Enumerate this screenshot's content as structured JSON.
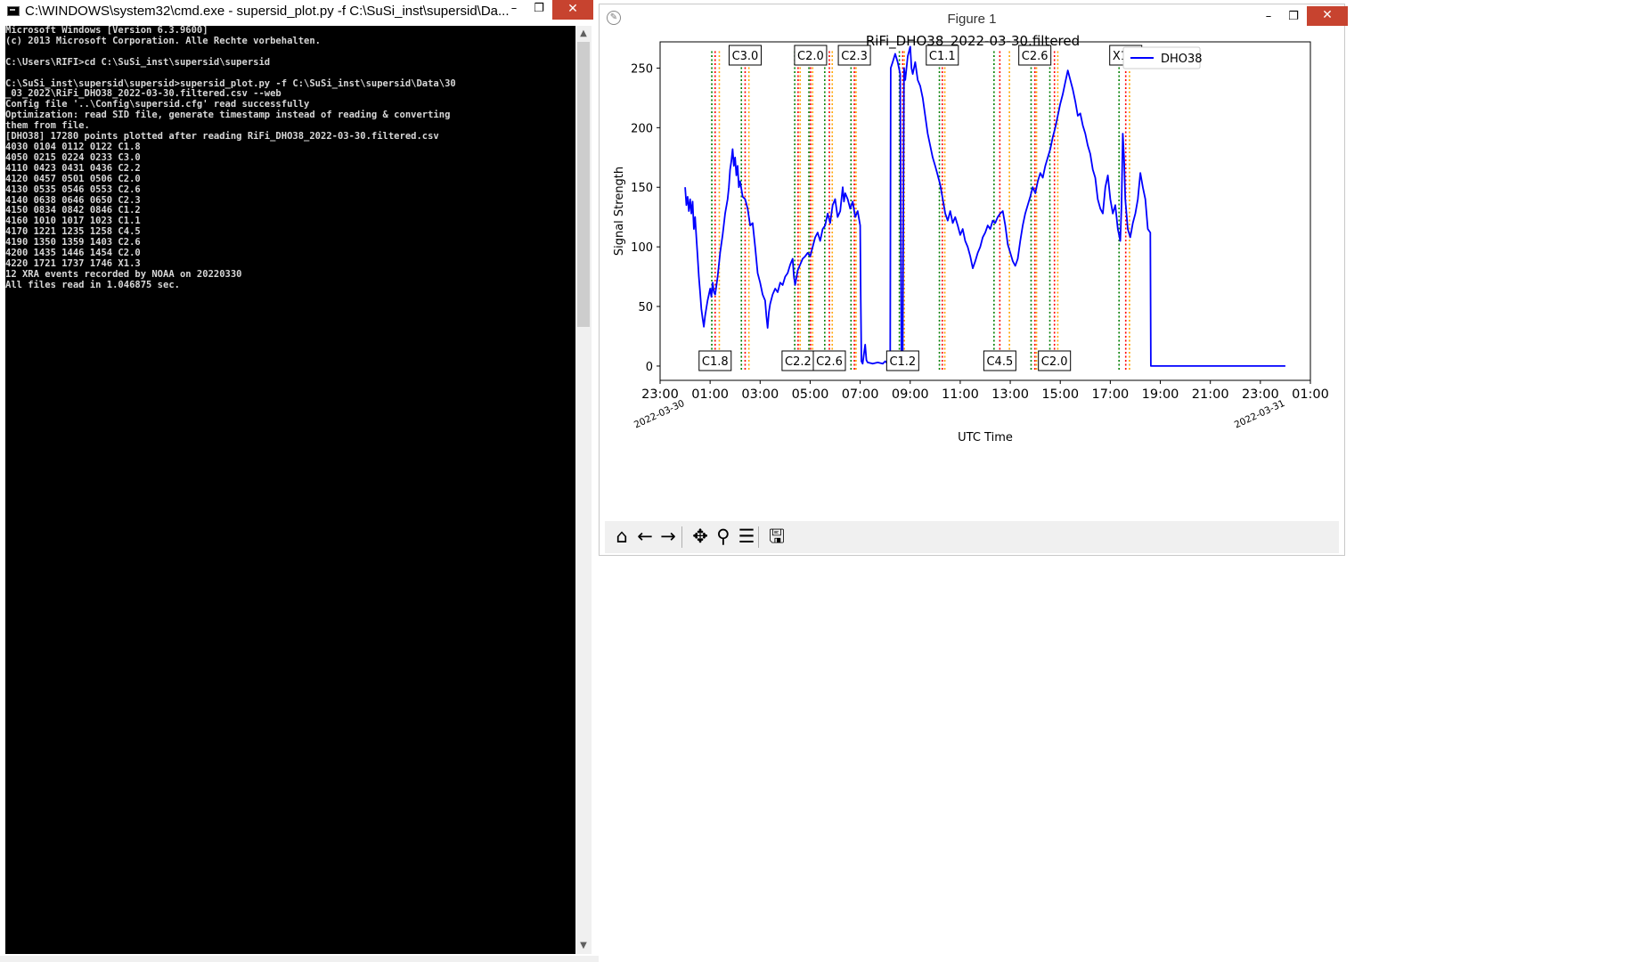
{
  "cmd_window": {
    "title": "C:\\WINDOWS\\system32\\cmd.exe - supersid_plot.py  -f C:\\SuSi_inst\\supersid\\Da...",
    "buttons": {
      "minimize": "–",
      "restore": "❐",
      "close": "✕"
    },
    "console_lines": [
      "Microsoft Windows [Version 6.3.9600]",
      "(c) 2013 Microsoft Corporation. Alle Rechte vorbehalten.",
      "",
      "C:\\Users\\RIFI>cd C:\\SuSi_inst\\supersid\\supersid",
      "",
      "C:\\SuSi_inst\\supersid\\supersid>supersid_plot.py -f C:\\SuSi_inst\\supersid\\Data\\30",
      "_03_2022\\RiFi_DHO38_2022-03-30.filtered.csv --web",
      "Config file '..\\Config\\supersid.cfg' read successfully",
      "Optimization: read SID file, generate timestamp instead of reading & converting",
      "them from file.",
      "[DHO38] 17280 points plotted after reading RiFi_DHO38_2022-03-30.filtered.csv",
      "4030 0104 0112 0122 C1.8",
      "4050 0215 0224 0233 C3.0",
      "4110 0423 0431 0436 C2.2",
      "4120 0457 0501 0506 C2.0",
      "4130 0535 0546 0553 C2.6",
      "4140 0638 0646 0650 C2.3",
      "4150 0834 0842 0846 C1.2",
      "4160 1010 1017 1023 C1.1",
      "4170 1221 1235 1258 C4.5",
      "4190 1350 1359 1403 C2.6",
      "4200 1435 1446 1454 C2.0",
      "4220 1721 1737 1746 X1.3",
      "12 XRA events recorded by NOAA on 20220330",
      "All files read in 1.046875 sec."
    ]
  },
  "figure_window": {
    "title": "Figure 1",
    "buttons": {
      "minimize": "–",
      "restore": "❐",
      "close": "✕"
    },
    "toolbar": [
      {
        "name": "home-icon",
        "glyph": "⌂"
      },
      {
        "name": "back-arrow-icon",
        "glyph": "←"
      },
      {
        "name": "forward-arrow-icon",
        "glyph": "→"
      },
      {
        "name": "pan-move-icon",
        "glyph": "✥"
      },
      {
        "name": "zoom-magnifier-icon",
        "glyph": "⚲"
      },
      {
        "name": "configure-subplots-icon",
        "glyph": "☰"
      },
      {
        "name": "save-disk-icon",
        "glyph": "🖫"
      }
    ]
  },
  "chart_data": {
    "type": "line",
    "title": "RiFi_DHO38_2022-03-30.filtered",
    "xlabel": "UTC Time",
    "ylabel": "Signal Strength",
    "x_unit": "UTC hour offset from 2022-03-30 00:00",
    "xlim": [
      -1.0,
      25.0
    ],
    "ylim": [
      -12,
      272
    ],
    "x_ticks": [
      {
        "at": -1,
        "label": "23:00"
      },
      {
        "at": 1,
        "label": "01:00"
      },
      {
        "at": 3,
        "label": "03:00"
      },
      {
        "at": 5,
        "label": "05:00"
      },
      {
        "at": 7,
        "label": "07:00"
      },
      {
        "at": 9,
        "label": "09:00"
      },
      {
        "at": 11,
        "label": "11:00"
      },
      {
        "at": 13,
        "label": "13:00"
      },
      {
        "at": 15,
        "label": "15:00"
      },
      {
        "at": 17,
        "label": "17:00"
      },
      {
        "at": 19,
        "label": "19:00"
      },
      {
        "at": 21,
        "label": "21:00"
      },
      {
        "at": 23,
        "label": "23:00"
      },
      {
        "at": 25,
        "label": "01:00"
      }
    ],
    "date_labels": [
      {
        "at": 0,
        "label": "2022-03-30"
      },
      {
        "at": 24,
        "label": "2022-03-31"
      }
    ],
    "y_ticks": [
      0,
      50,
      100,
      150,
      200,
      250
    ],
    "grid": false,
    "legend": {
      "position": "top-right",
      "entries": [
        {
          "name": "DHO38",
          "color": "#0000ff"
        }
      ]
    },
    "series": [
      {
        "name": "DHO38",
        "color": "#0000ff",
        "points": [
          [
            0.0,
            150
          ],
          [
            0.05,
            135
          ],
          [
            0.1,
            142
          ],
          [
            0.15,
            130
          ],
          [
            0.2,
            140
          ],
          [
            0.25,
            128
          ],
          [
            0.3,
            138
          ],
          [
            0.35,
            115
          ],
          [
            0.4,
            125
          ],
          [
            0.45,
            108
          ],
          [
            0.5,
            92
          ],
          [
            0.55,
            75
          ],
          [
            0.6,
            62
          ],
          [
            0.65,
            48
          ],
          [
            0.7,
            40
          ],
          [
            0.75,
            33
          ],
          [
            0.8,
            42
          ],
          [
            0.9,
            55
          ],
          [
            1.0,
            65
          ],
          [
            1.05,
            58
          ],
          [
            1.1,
            70
          ],
          [
            1.15,
            62
          ],
          [
            1.2,
            60
          ],
          [
            1.3,
            75
          ],
          [
            1.4,
            95
          ],
          [
            1.5,
            110
          ],
          [
            1.6,
            128
          ],
          [
            1.7,
            140
          ],
          [
            1.75,
            150
          ],
          [
            1.8,
            165
          ],
          [
            1.85,
            172
          ],
          [
            1.9,
            182
          ],
          [
            1.95,
            168
          ],
          [
            2.0,
            175
          ],
          [
            2.05,
            160
          ],
          [
            2.1,
            168
          ],
          [
            2.15,
            150
          ],
          [
            2.2,
            155
          ],
          [
            2.3,
            142
          ],
          [
            2.4,
            140
          ],
          [
            2.5,
            132
          ],
          [
            2.6,
            118
          ],
          [
            2.7,
            120
          ],
          [
            2.8,
            100
          ],
          [
            2.9,
            78
          ],
          [
            3.0,
            70
          ],
          [
            3.1,
            60
          ],
          [
            3.2,
            55
          ],
          [
            3.25,
            42
          ],
          [
            3.3,
            32
          ],
          [
            3.35,
            45
          ],
          [
            3.4,
            52
          ],
          [
            3.5,
            60
          ],
          [
            3.6,
            65
          ],
          [
            3.7,
            62
          ],
          [
            3.8,
            70
          ],
          [
            3.9,
            68
          ],
          [
            4.0,
            75
          ],
          [
            4.1,
            78
          ],
          [
            4.2,
            85
          ],
          [
            4.3,
            90
          ],
          [
            4.35,
            75
          ],
          [
            4.4,
            68
          ],
          [
            4.5,
            80
          ],
          [
            4.6,
            85
          ],
          [
            4.7,
            90
          ],
          [
            4.8,
            92
          ],
          [
            4.9,
            95
          ],
          [
            5.0,
            92
          ],
          [
            5.1,
            100
          ],
          [
            5.2,
            108
          ],
          [
            5.3,
            112
          ],
          [
            5.4,
            105
          ],
          [
            5.5,
            115
          ],
          [
            5.6,
            118
          ],
          [
            5.7,
            128
          ],
          [
            5.8,
            120
          ],
          [
            5.9,
            135
          ],
          [
            6.0,
            140
          ],
          [
            6.1,
            125
          ],
          [
            6.2,
            130
          ],
          [
            6.3,
            150
          ],
          [
            6.35,
            138
          ],
          [
            6.4,
            145
          ],
          [
            6.5,
            140
          ],
          [
            6.6,
            132
          ],
          [
            6.7,
            138
          ],
          [
            6.8,
            125
          ],
          [
            6.9,
            130
          ],
          [
            7.0,
            118
          ],
          [
            7.02,
            60
          ],
          [
            7.05,
            4
          ],
          [
            7.1,
            2
          ],
          [
            7.2,
            18
          ],
          [
            7.25,
            5
          ],
          [
            7.3,
            3
          ],
          [
            7.5,
            2
          ],
          [
            7.7,
            3
          ],
          [
            7.9,
            2
          ],
          [
            8.0,
            4
          ],
          [
            8.1,
            2
          ],
          [
            8.2,
            5
          ],
          [
            8.22,
            250
          ],
          [
            8.3,
            255
          ],
          [
            8.4,
            262
          ],
          [
            8.5,
            255
          ],
          [
            8.6,
            245
          ],
          [
            8.65,
            4
          ],
          [
            8.7,
            3
          ],
          [
            8.75,
            250
          ],
          [
            8.8,
            240
          ],
          [
            8.9,
            260
          ],
          [
            9.0,
            268
          ],
          [
            9.05,
            250
          ],
          [
            9.1,
            245
          ],
          [
            9.2,
            255
          ],
          [
            9.3,
            240
          ],
          [
            9.4,
            235
          ],
          [
            9.5,
            225
          ],
          [
            9.6,
            210
          ],
          [
            9.7,
            195
          ],
          [
            9.8,
            185
          ],
          [
            9.9,
            175
          ],
          [
            10.0,
            168
          ],
          [
            10.1,
            160
          ],
          [
            10.2,
            152
          ],
          [
            10.3,
            140
          ],
          [
            10.4,
            128
          ],
          [
            10.5,
            122
          ],
          [
            10.6,
            130
          ],
          [
            10.7,
            120
          ],
          [
            10.8,
            125
          ],
          [
            10.9,
            118
          ],
          [
            11.0,
            110
          ],
          [
            11.1,
            115
          ],
          [
            11.2,
            105
          ],
          [
            11.3,
            100
          ],
          [
            11.4,
            92
          ],
          [
            11.5,
            82
          ],
          [
            11.6,
            88
          ],
          [
            11.7,
            95
          ],
          [
            11.8,
            100
          ],
          [
            11.9,
            108
          ],
          [
            12.0,
            112
          ],
          [
            12.1,
            118
          ],
          [
            12.2,
            115
          ],
          [
            12.3,
            122
          ],
          [
            12.4,
            120
          ],
          [
            12.5,
            125
          ],
          [
            12.6,
            128
          ],
          [
            12.7,
            130
          ],
          [
            12.8,
            118
          ],
          [
            12.9,
            102
          ],
          [
            13.0,
            95
          ],
          [
            13.1,
            88
          ],
          [
            13.2,
            84
          ],
          [
            13.3,
            90
          ],
          [
            13.4,
            105
          ],
          [
            13.5,
            118
          ],
          [
            13.6,
            128
          ],
          [
            13.7,
            135
          ],
          [
            13.8,
            142
          ],
          [
            13.9,
            150
          ],
          [
            14.0,
            145
          ],
          [
            14.1,
            155
          ],
          [
            14.2,
            162
          ],
          [
            14.3,
            158
          ],
          [
            14.4,
            168
          ],
          [
            14.5,
            175
          ],
          [
            14.6,
            182
          ],
          [
            14.7,
            192
          ],
          [
            14.8,
            200
          ],
          [
            14.9,
            210
          ],
          [
            15.0,
            220
          ],
          [
            15.1,
            228
          ],
          [
            15.2,
            238
          ],
          [
            15.3,
            248
          ],
          [
            15.4,
            240
          ],
          [
            15.5,
            232
          ],
          [
            15.6,
            222
          ],
          [
            15.7,
            210
          ],
          [
            15.8,
            212
          ],
          [
            15.9,
            202
          ],
          [
            16.0,
            195
          ],
          [
            16.1,
            185
          ],
          [
            16.2,
            178
          ],
          [
            16.3,
            165
          ],
          [
            16.4,
            158
          ],
          [
            16.5,
            140
          ],
          [
            16.6,
            132
          ],
          [
            16.7,
            128
          ],
          [
            16.8,
            150
          ],
          [
            16.9,
            160
          ],
          [
            17.0,
            140
          ],
          [
            17.1,
            128
          ],
          [
            17.2,
            135
          ],
          [
            17.3,
            115
          ],
          [
            17.4,
            105
          ],
          [
            17.45,
            135
          ],
          [
            17.5,
            195
          ],
          [
            17.55,
            175
          ],
          [
            17.6,
            140
          ],
          [
            17.7,
            115
          ],
          [
            17.8,
            108
          ],
          [
            17.9,
            120
          ],
          [
            18.0,
            128
          ],
          [
            18.1,
            140
          ],
          [
            18.2,
            162
          ],
          [
            18.3,
            150
          ],
          [
            18.4,
            140
          ],
          [
            18.5,
            115
          ],
          [
            18.6,
            112
          ],
          [
            18.62,
            0
          ],
          [
            20.0,
            0
          ],
          [
            22.0,
            0
          ],
          [
            24.0,
            0
          ]
        ]
      }
    ],
    "xra_events": [
      {
        "start": 1.067,
        "peak": 1.2,
        "end": 1.367,
        "label": "C1.8",
        "label_pos": "bottom"
      },
      {
        "start": 2.25,
        "peak": 2.4,
        "end": 2.55,
        "label": "C3.0",
        "label_pos": "top"
      },
      {
        "start": 4.383,
        "peak": 4.517,
        "end": 4.6,
        "label": "C2.2",
        "label_pos": "bottom"
      },
      {
        "start": 4.95,
        "peak": 5.017,
        "end": 5.1,
        "label": "C2.0",
        "label_pos": "top"
      },
      {
        "start": 5.583,
        "peak": 5.767,
        "end": 5.883,
        "label": "C2.6",
        "label_pos": "bottom"
      },
      {
        "start": 6.633,
        "peak": 6.767,
        "end": 6.833,
        "label": "C2.3",
        "label_pos": "top"
      },
      {
        "start": 8.567,
        "peak": 8.7,
        "end": 8.767,
        "label": "C1.2",
        "label_pos": "bottom"
      },
      {
        "start": 10.167,
        "peak": 10.283,
        "end": 10.383,
        "label": "C1.1",
        "label_pos": "top"
      },
      {
        "start": 12.35,
        "peak": 12.583,
        "end": 12.967,
        "label": "C4.5",
        "label_pos": "bottom"
      },
      {
        "start": 13.833,
        "peak": 13.983,
        "end": 14.05,
        "label": "C2.6",
        "label_pos": "top"
      },
      {
        "start": 14.583,
        "peak": 14.767,
        "end": 14.9,
        "label": "C2.0",
        "label_pos": "bottom"
      },
      {
        "start": 17.35,
        "peak": 17.617,
        "end": 17.767,
        "label": "X1.3",
        "label_pos": "top"
      }
    ],
    "event_colors": {
      "start": "#008000",
      "peak": "#ff0000",
      "end": "#ffa500"
    }
  }
}
